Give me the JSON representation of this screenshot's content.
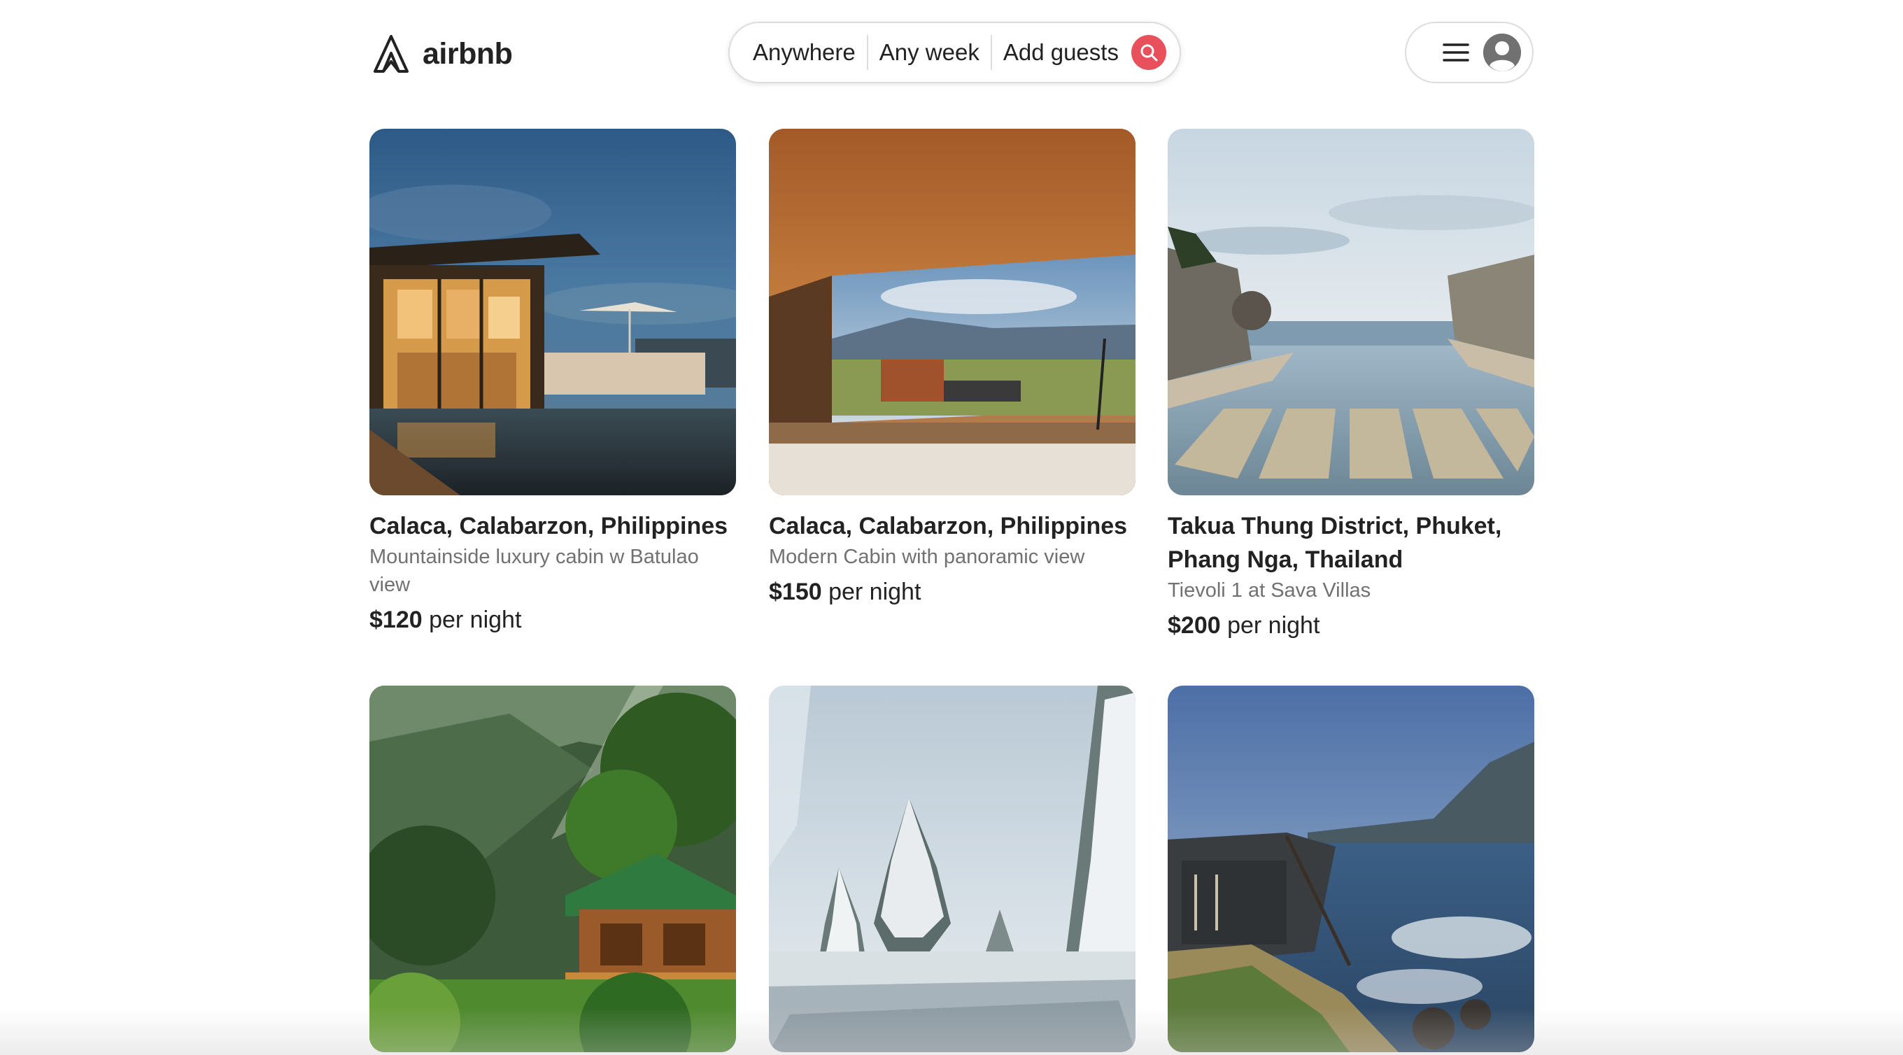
{
  "header": {
    "logo_text": "airbnb",
    "search": {
      "location_label": "Anywhere",
      "week_label": "Any week",
      "guests_label": "Add guests"
    },
    "colors": {
      "brand": "#e8515c",
      "border": "#dddddd"
    }
  },
  "listings": [
    {
      "location": "Calaca, Calabarzon, Philippines",
      "title": "Mountainside luxury cabin w Batulao view",
      "price": "$120",
      "price_unit": "per night",
      "image": "modern-villa-pool-dusk"
    },
    {
      "location": "Calaca, Calabarzon, Philippines",
      "title": "Modern Cabin with panoramic view",
      "price": "$150",
      "price_unit": "per night",
      "image": "bedroom-panoramic-window"
    },
    {
      "location": "Takua Thung District, Phuket, Phang Nga, Thailand",
      "title": "Tievoli 1 at Sava Villas",
      "price": "$200",
      "price_unit": "per night",
      "image": "infinity-pool-sea"
    },
    {
      "image": "treehouse-forest"
    },
    {
      "image": "snowy-pine-forest"
    },
    {
      "image": "coastal-cliff-cabin"
    }
  ]
}
